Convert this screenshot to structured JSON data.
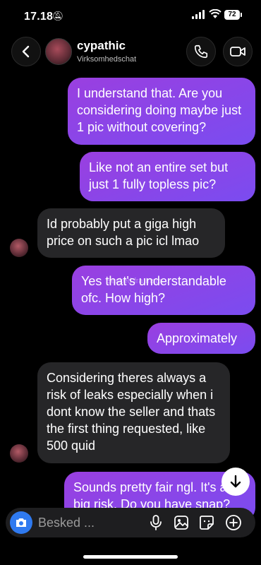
{
  "status_bar": {
    "time": "17.18",
    "battery": "72"
  },
  "header": {
    "name": "cypathic",
    "subtitle": "Virksomhedschat"
  },
  "messages": [
    {
      "from": "me",
      "text": "I understand that. Are you considering doing maybe just 1 pic without covering?"
    },
    {
      "from": "me",
      "text": "Like not an entire set but just 1 fully topless pic?"
    },
    {
      "from": "them",
      "text": "Id probably put a giga high price on such a pic icl lmao"
    },
    {
      "from": "me",
      "text": "Yes that's understandable ofc. How high?"
    },
    {
      "from": "me",
      "text": "Approximately"
    },
    {
      "from": "them",
      "text": "Considering theres always a risk of leaks especially when i dont know the seller and thats the first thing requested, like 500 quid"
    },
    {
      "from": "me",
      "text": "Sounds pretty fair ngl. It's a big risk. Do you have snap?"
    }
  ],
  "watermark": "Besked fra Insta...",
  "composer": {
    "placeholder": "Besked ..."
  },
  "icons": {
    "back": "chevron-left-icon",
    "call": "phone-icon",
    "video": "video-camera-icon",
    "camera": "camera-icon",
    "mic": "microphone-icon",
    "gallery": "image-icon",
    "sticker": "sticker-icon",
    "add": "plus-circle-icon",
    "scroll": "arrow-down-icon"
  },
  "colors": {
    "sent_bubble": "#8a44ea",
    "received_bubble": "#262628",
    "camera_button": "#2f7af0"
  }
}
